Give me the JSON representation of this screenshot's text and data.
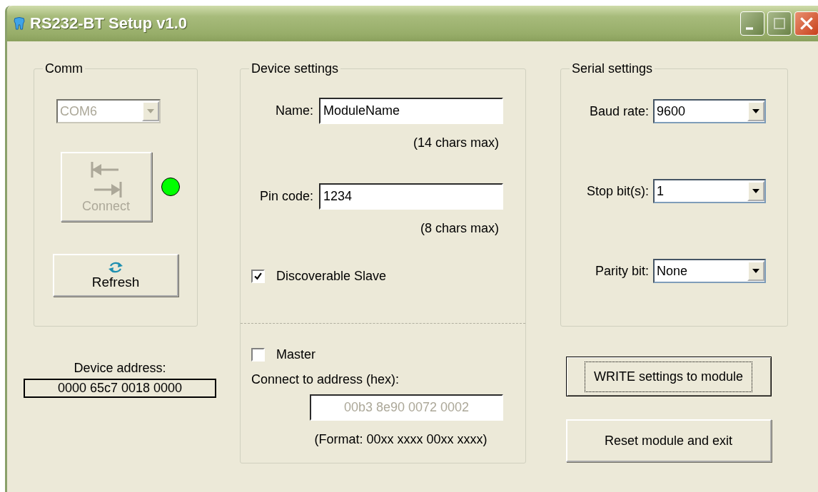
{
  "window": {
    "title": "RS232-BT Setup v1.0"
  },
  "comm": {
    "title": "Comm",
    "port": {
      "value": "COM6",
      "disabled": true
    },
    "connect_button": {
      "label": "Connect",
      "disabled": true
    },
    "status_led": {
      "color": "#00ff00"
    },
    "refresh_button": {
      "label": "Refresh"
    }
  },
  "device_address": {
    "label": "Device address:",
    "value": "0000 65c7 0018 0000"
  },
  "device_settings": {
    "title": "Device settings",
    "name": {
      "label": "Name:",
      "value": "ModuleName",
      "hint": "(14 chars max)"
    },
    "pin_code": {
      "label": "Pin code:",
      "value": "1234",
      "hint": "(8 chars max)"
    },
    "discoverable_slave": {
      "label": "Discoverable Slave",
      "checked": true
    },
    "master": {
      "label": "Master",
      "checked": false
    },
    "connect_address": {
      "label": "Connect to address (hex):",
      "value": "00b3 8e90 0072 0002",
      "disabled": true,
      "format": "(Format: 00xx xxxx 00xx xxxx)"
    }
  },
  "serial_settings": {
    "title": "Serial settings",
    "fields": [
      {
        "label": "Baud rate:",
        "value": "9600"
      },
      {
        "label": "Stop bit(s):",
        "value": "1"
      },
      {
        "label": "Parity bit:",
        "value": "None"
      }
    ]
  },
  "buttons": [
    {
      "label": "WRITE settings to module",
      "focused": true
    },
    {
      "label": "Reset module and exit",
      "focused": false
    }
  ]
}
